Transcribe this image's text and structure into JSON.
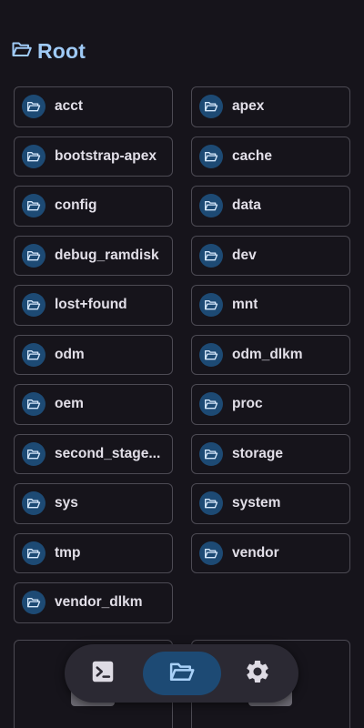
{
  "header": {
    "title": "Root",
    "icon": "folder-open-icon"
  },
  "folders": [
    {
      "label": "acct",
      "icon": "folder-icon"
    },
    {
      "label": "apex",
      "icon": "folder-icon"
    },
    {
      "label": "bootstrap-apex",
      "icon": "folder-icon"
    },
    {
      "label": "cache",
      "icon": "folder-icon"
    },
    {
      "label": "config",
      "icon": "folder-icon"
    },
    {
      "label": "data",
      "icon": "folder-icon"
    },
    {
      "label": "debug_ramdisk",
      "icon": "folder-icon"
    },
    {
      "label": "dev",
      "icon": "folder-icon"
    },
    {
      "label": "lost+found",
      "icon": "folder-icon"
    },
    {
      "label": "mnt",
      "icon": "folder-icon"
    },
    {
      "label": "odm",
      "icon": "folder-icon"
    },
    {
      "label": "odm_dlkm",
      "icon": "folder-icon"
    },
    {
      "label": "oem",
      "icon": "folder-icon"
    },
    {
      "label": "proc",
      "icon": "folder-icon"
    },
    {
      "label": "second_stage...",
      "icon": "folder-icon"
    },
    {
      "label": "storage",
      "icon": "folder-icon"
    },
    {
      "label": "sys",
      "icon": "folder-icon"
    },
    {
      "label": "system",
      "icon": "folder-icon"
    },
    {
      "label": "tmp",
      "icon": "folder-icon"
    },
    {
      "label": "vendor",
      "icon": "folder-icon"
    },
    {
      "label": "vendor_dlkm",
      "icon": "folder-icon"
    }
  ],
  "bottom_nav": {
    "items": [
      {
        "name": "terminal",
        "icon": "terminal-icon",
        "selected": false
      },
      {
        "name": "files",
        "icon": "folder-open-icon",
        "selected": true
      },
      {
        "name": "settings",
        "icon": "gear-icon",
        "selected": false
      }
    ]
  },
  "colors": {
    "background": "#16141b",
    "accent": "#9fcaf6",
    "icon_circle": "#1d4a74",
    "tile_border": "#4c4a53",
    "nav_background": "#2b2933"
  }
}
